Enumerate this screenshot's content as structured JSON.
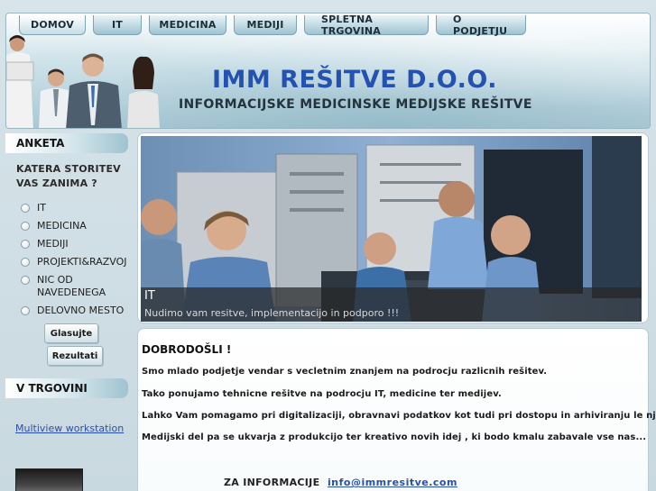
{
  "nav": {
    "tabs": [
      {
        "label": "DOMOV",
        "active": true
      },
      {
        "label": "IT",
        "active": false
      },
      {
        "label": "MEDICINA",
        "active": false
      },
      {
        "label": "MEDIJI",
        "active": false
      },
      {
        "label": "SPLETNA TRGOVINA",
        "active": false
      },
      {
        "label": "O PODJETJU",
        "active": false
      }
    ]
  },
  "header": {
    "title": "IMM REŠITVE D.O.O.",
    "subtitle": "INFORMACIJSKE MEDICINSKE MEDIJSKE REŠITVE"
  },
  "sidebar": {
    "poll_heading": "ANKETA",
    "poll_question": "KATERA STORITEV VAS ZANIMA ?",
    "poll_options": [
      "IT",
      "MEDICINA",
      "MEDIJI",
      "PROJEKTI&RAZVOJ",
      "NIC OD NAVEDENEGA",
      "DELOVNO MESTO"
    ],
    "vote_button": "Glasujte",
    "results_button": "Rezultati",
    "shop_heading": "V TRGOVINI",
    "shop_link": "Multiview workstation"
  },
  "banner": {
    "caption_title": "IT",
    "caption_text": "Nudimo vam resitve, implementacijo in podporo !!!"
  },
  "main": {
    "welcome": "DOBRODOŠLI !",
    "paragraphs": [
      "Smo mlado podjetje vendar s vecletnim znanjem na podrocju razlicnih rešitev.",
      "Tako ponujamo tehnicne rešitve na podrocju IT, medicine ter medijev.",
      "Lahko Vam pomagamo pri digitalizaciji, obravnavi podatkov kot tudi pri dostopu in arhiviranju le njih.",
      "Medijski del pa se ukvarja z produkcijo ter kreativo novih idej , ki bodo kmalu zabavale vse nas..."
    ],
    "contact_label": "ZA INFORMACIJE   :",
    "contact_email": "info@immresitve.com"
  },
  "colors": {
    "title_blue": "#2352b0",
    "link_blue": "#2b4fa8",
    "header_teal": "#a9c8d4"
  }
}
